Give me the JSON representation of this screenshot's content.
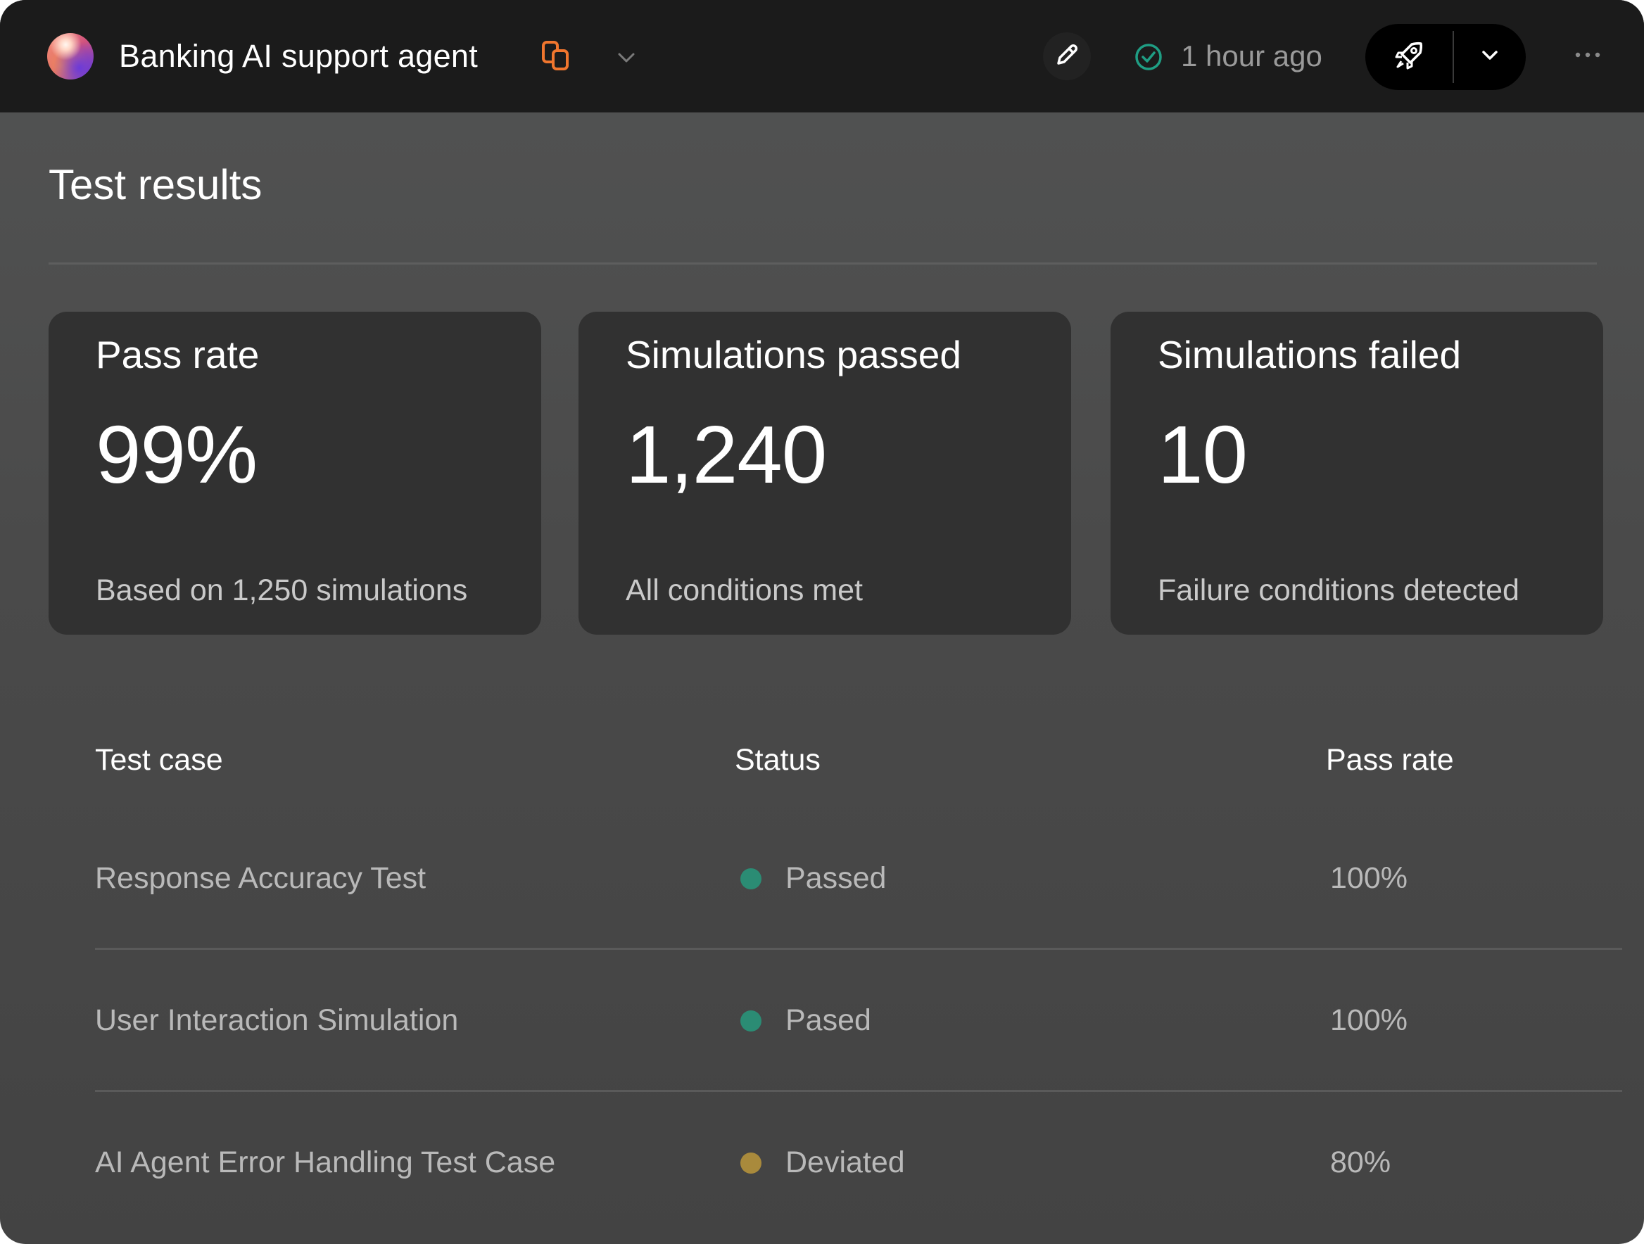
{
  "header": {
    "agent_name": "Banking AI support agent",
    "last_updated": "1 hour ago",
    "icons": {
      "avatar": "gradient-orb",
      "copy": "copy-icon",
      "dropdown": "chevron-down-icon",
      "edit": "pencil-icon",
      "status": "check-circle-icon",
      "deploy": "rocket-icon",
      "deploy_menu": "chevron-down-icon",
      "more": "more-horizontal-icon"
    }
  },
  "page": {
    "title": "Test results"
  },
  "cards": [
    {
      "label": "Pass rate",
      "value": "99%",
      "subtitle": "Based on 1,250 simulations"
    },
    {
      "label": "Simulations passed",
      "value": "1,240",
      "subtitle": "All conditions met"
    },
    {
      "label": "Simulations failed",
      "value": "10",
      "subtitle": "Failure conditions detected"
    }
  ],
  "table": {
    "columns": [
      "Test case",
      "Status",
      "Pass rate"
    ],
    "rows": [
      {
        "name": "Response Accuracy Test",
        "status": "Passed",
        "status_color": "#2b8c74",
        "pass_rate": "100%"
      },
      {
        "name": "User Interaction Simulation",
        "status": "Pased",
        "status_color": "#2b8c74",
        "pass_rate": "100%"
      },
      {
        "name": "AI Agent Error Handling Test Case",
        "status": "Deviated",
        "status_color": "#a98a3c",
        "pass_rate": "80%"
      }
    ]
  },
  "colors": {
    "accent_orange": "#f0762e",
    "success_teal": "#2b8c74",
    "warning_gold": "#a98a3c"
  }
}
